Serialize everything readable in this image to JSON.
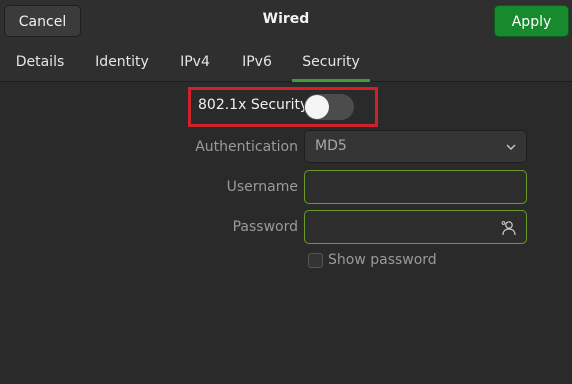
{
  "header": {
    "cancel_label": "Cancel",
    "title": "Wired",
    "apply_label": "Apply"
  },
  "tabs": [
    {
      "label": "Details",
      "active": false
    },
    {
      "label": "Identity",
      "active": false
    },
    {
      "label": "IPv4",
      "active": false
    },
    {
      "label": "IPv6",
      "active": false
    },
    {
      "label": "Security",
      "active": true
    }
  ],
  "security": {
    "toggle_label": "802.1x Security",
    "toggle_on": false,
    "authentication_label": "Authentication",
    "authentication_value": "MD5",
    "username_label": "Username",
    "username_value": "",
    "password_label": "Password",
    "password_value": "",
    "show_password_label": "Show password",
    "show_password_checked": false
  },
  "colors": {
    "accent_green": "#3c9c41",
    "apply_button": "#168a2d",
    "highlight_border": "#d0202a"
  }
}
